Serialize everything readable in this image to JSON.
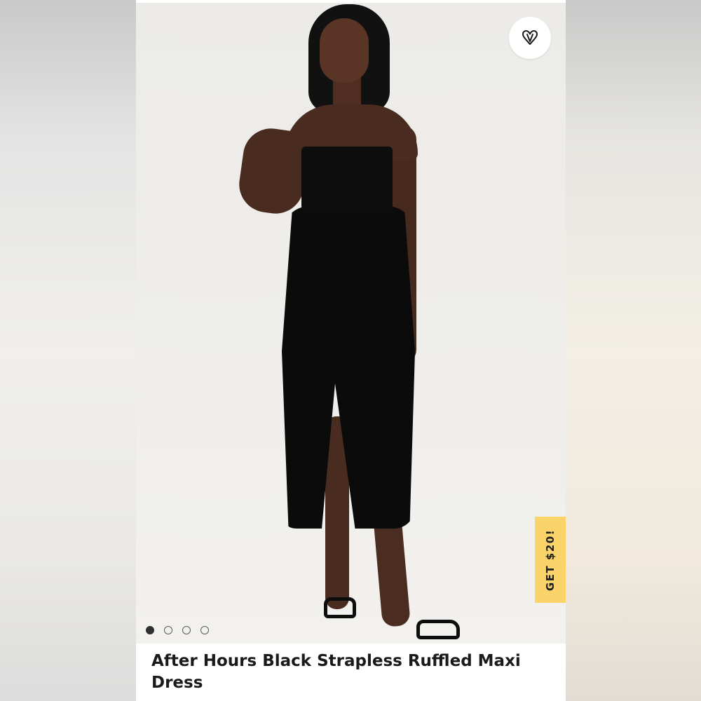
{
  "product": {
    "title": "After Hours Black Strapless Ruffled Maxi Dress",
    "image_alt": "Model wearing black strapless ruffled maxi dress with high slit"
  },
  "favorite": {
    "icon": "heart-v-icon"
  },
  "promo": {
    "label": "GET $20!",
    "color": "#fad46b"
  },
  "carousel": {
    "total_images": 4,
    "active_index": 0
  }
}
